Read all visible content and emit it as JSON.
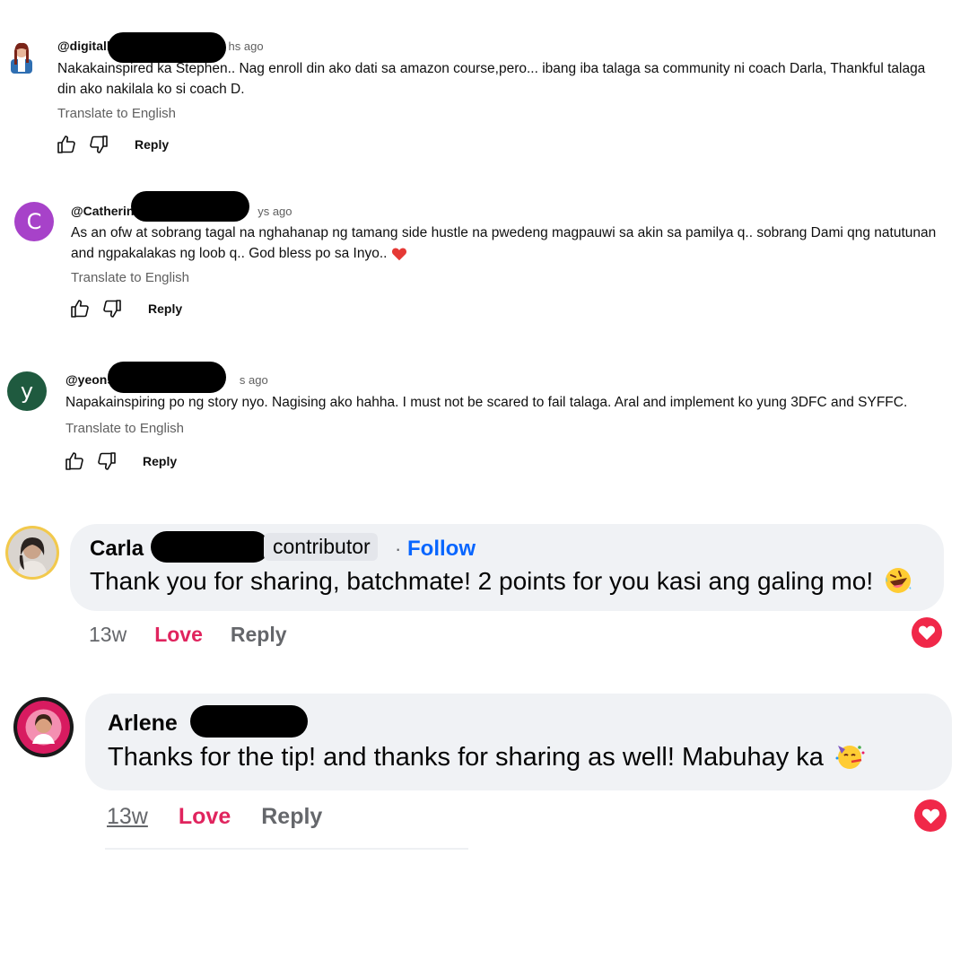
{
  "yt_comments": [
    {
      "handle": "@digitall",
      "ago": "hs ago",
      "text_line1": "Nakakainspired ka Stephen.. Nag enroll din ako dati sa amazon course,pero... ibang iba talaga sa community ni coach Darla,  Thankful talaga",
      "text_line2": "din ako nakilala ko si coach D.",
      "translate": "Translate to English",
      "reply": "Reply"
    },
    {
      "avatar_letter": "C",
      "avatar_color": "#a742c9",
      "handle": "@Catherin",
      "ago": "ys ago",
      "text_line1": "As an ofw at sobrang tagal na nghahanap ng tamang side hustle na pwedeng magpauwi sa akin sa pamilya q.. sobrang Dami qng natutunan",
      "text_line2": "and ngpakalakas ng loob q.. God bless po sa Inyo..",
      "emoji": "red-heart",
      "translate": "Translate to English",
      "reply": "Reply"
    },
    {
      "avatar_letter": "y",
      "avatar_color": "#1f5a3f",
      "handle": "@yeons",
      "ago": "s ago",
      "text_line1": "Napakainspiring po ng story nyo. Nagising ako hahha. I must not be scared to fail talaga. Aral and implement ko yung 3DFC and SYFFC.",
      "translate": "Translate to English",
      "reply": "Reply"
    }
  ],
  "fb_comments": [
    {
      "name": "Carla",
      "badge": "contributor",
      "separator": "·",
      "follow": "Follow",
      "text": "Thank you for sharing, batchmate! 2 points for you kasi ang galing mo!",
      "emoji": "rolling-on-floor-laughing",
      "time": "13w",
      "love": "Love",
      "reply": "Reply"
    },
    {
      "name": "Arlene",
      "text": "Thanks for the tip! and thanks for sharing as well! Mabuhay ka",
      "emoji": "partying-face",
      "time": "13w",
      "love": "Love",
      "reply": "Reply"
    }
  ],
  "colors": {
    "fb_bubble": "#f0f2f5",
    "love_red": "#e0245e",
    "follow_blue": "#0866ff",
    "heart_badge": "#f02849"
  }
}
